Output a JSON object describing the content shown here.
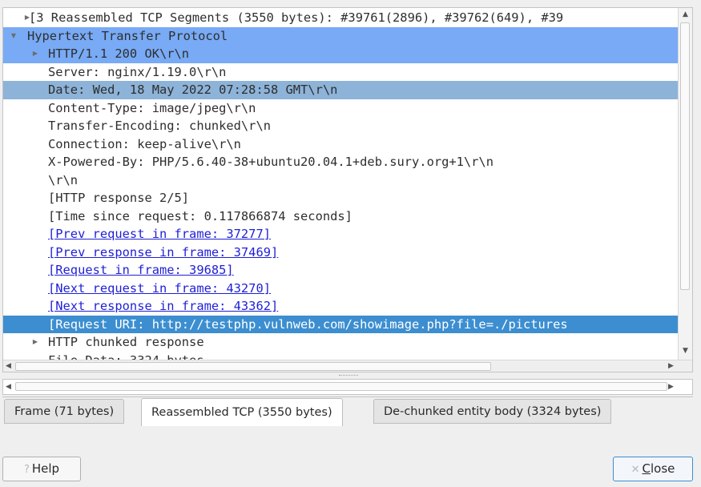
{
  "tree": {
    "rows": [
      {
        "toggle": "▶",
        "text": "[3 Reassembled TCP Segments (3550 bytes): #39761(2896), #39762(649), #39",
        "style": "normal",
        "link": false
      },
      {
        "toggle": "▼",
        "text": "Hypertext Transfer Protocol",
        "style": "sel-primary",
        "link": false
      },
      {
        "toggle": "▶",
        "text": "HTTP/1.1 200 OK\\r\\n",
        "style": "sel-primary",
        "link": false
      },
      {
        "toggle": "",
        "text": "Server: nginx/1.19.0\\r\\n",
        "style": "normal",
        "link": false
      },
      {
        "toggle": "",
        "text": "Date: Wed, 18 May 2022 07:28:58 GMT\\r\\n",
        "style": "sel-secondary",
        "link": false
      },
      {
        "toggle": "",
        "text": "Content-Type: image/jpeg\\r\\n",
        "style": "normal",
        "link": false
      },
      {
        "toggle": "",
        "text": "Transfer-Encoding: chunked\\r\\n",
        "style": "normal",
        "link": false
      },
      {
        "toggle": "",
        "text": "Connection: keep-alive\\r\\n",
        "style": "normal",
        "link": false
      },
      {
        "toggle": "",
        "text": "X-Powered-By: PHP/5.6.40-38+ubuntu20.04.1+deb.sury.org+1\\r\\n",
        "style": "normal",
        "link": false
      },
      {
        "toggle": "",
        "text": "\\r\\n",
        "style": "normal",
        "link": false
      },
      {
        "toggle": "",
        "text": "[HTTP response 2/5]",
        "style": "normal",
        "link": false
      },
      {
        "toggle": "",
        "text": "[Time since request: 0.117866874 seconds]",
        "style": "normal",
        "link": false
      },
      {
        "toggle": "",
        "text": "[Prev request in frame: 37277]",
        "style": "normal",
        "link": true
      },
      {
        "toggle": "",
        "text": "[Prev response in frame: 37469]",
        "style": "normal",
        "link": true
      },
      {
        "toggle": "",
        "text": "[Request in frame: 39685]",
        "style": "normal",
        "link": true
      },
      {
        "toggle": "",
        "text": "[Next request in frame: 43270]",
        "style": "normal",
        "link": true
      },
      {
        "toggle": "",
        "text": "[Next response in frame: 43362]",
        "style": "normal",
        "link": true
      },
      {
        "toggle": "",
        "text": "[Request URI: http://testphp.vulnweb.com/showimage.php?file=./pictures",
        "style": "sel-current",
        "link": true
      },
      {
        "toggle": "▶",
        "text": "HTTP chunked response",
        "style": "normal",
        "link": false
      },
      {
        "toggle": "",
        "text": "File Data: 3324 bytes",
        "style": "normal",
        "link": false
      }
    ],
    "indent_levels": [
      1,
      0,
      1,
      2,
      2,
      2,
      2,
      2,
      2,
      2,
      2,
      2,
      2,
      2,
      2,
      2,
      2,
      2,
      1,
      2
    ]
  },
  "tabs": [
    {
      "label": "Frame (71 bytes)",
      "active": false
    },
    {
      "label": "Reassembled TCP (3550 bytes)",
      "active": true
    },
    {
      "label": "De-chunked entity body (3324 bytes)",
      "active": false
    }
  ],
  "buttons": {
    "help_label": "Help",
    "close_label": "Close",
    "close_mnemonic": "C"
  },
  "colors": {
    "selection_primary": "#78aaf5",
    "selection_secondary": "#8db3d8",
    "selection_current": "#3c8ed0",
    "link": "#1f1fd6"
  },
  "icons": {
    "expand": "chevron-right-icon",
    "collapse": "chevron-down-icon",
    "help": "question-icon",
    "close": "close-icon"
  }
}
